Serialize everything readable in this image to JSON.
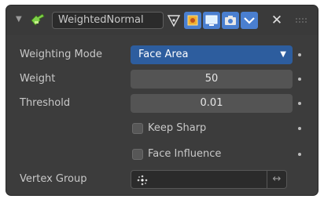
{
  "header": {
    "collapse_icon": "triangle-down-icon",
    "modifier_icon": "weighted-normal-icon",
    "modifier_name": "WeightedNormal",
    "buttons": [
      "edit-mode-icon",
      "cage-icon",
      "realtime-icon",
      "render-icon"
    ],
    "dropdown_icon": "chevron-down-icon",
    "close_icon": "close-icon",
    "drag_icon": "drag-handle-icon"
  },
  "fields": {
    "weighting_mode": {
      "label": "Weighting Mode",
      "value": "Face Area"
    },
    "weight": {
      "label": "Weight",
      "value": "50"
    },
    "threshold": {
      "label": "Threshold",
      "value": "0.01"
    },
    "keep_sharp": {
      "label": "Keep Sharp",
      "checked": false
    },
    "face_influence": {
      "label": "Face Influence",
      "checked": false
    },
    "vertex_group": {
      "label": "Vertex Group",
      "value": "",
      "icon": "vertex-group-icon",
      "invert_icon": "invert-arrows-icon"
    }
  },
  "colors": {
    "panel_bg": "#3c3c3c",
    "dropdown_accent": "#2d5d9e",
    "field_bg": "#545454",
    "header_button_blue": "#4a7fd0",
    "modifier_icon_green": "#7fd14a"
  }
}
